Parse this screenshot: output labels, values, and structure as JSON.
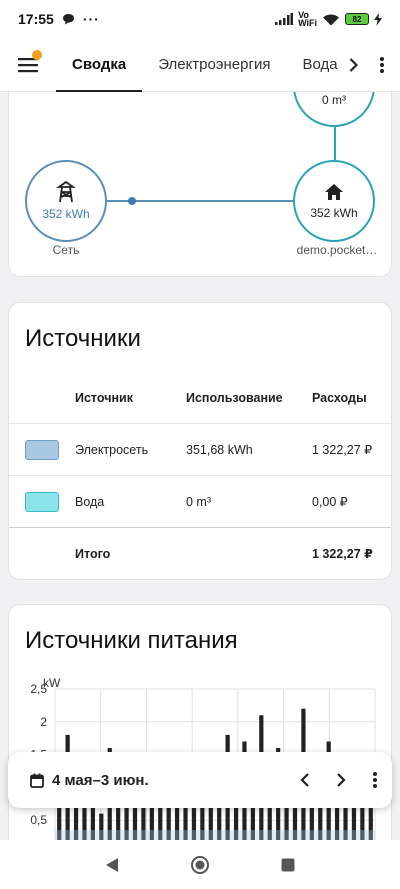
{
  "status_bar": {
    "time": "17:55",
    "network_label_top": "Vo",
    "network_label_bottom": "WiFi",
    "battery": "82"
  },
  "app_bar": {
    "tabs": [
      {
        "label": "Сводка",
        "active": true
      },
      {
        "label": "Электроэнергия",
        "active": false
      },
      {
        "label": "Вода",
        "active": false
      }
    ]
  },
  "flow": {
    "water_value": "0 m³",
    "grid_value": "352 kWh",
    "grid_label": "Сеть",
    "home_value": "352 kWh",
    "home_label": "demo.pocket…"
  },
  "sources": {
    "title": "Источники",
    "headers": {
      "source": "Источник",
      "usage": "Использование",
      "cost": "Расходы"
    },
    "rows": [
      {
        "name": "Электросеть",
        "usage": "351,68 kWh",
        "cost": "1 322,27 ₽",
        "color": "#a9c8e2",
        "border": "#6f9fc6"
      },
      {
        "name": "Вода",
        "usage": "0 m³",
        "cost": "0,00 ₽",
        "color": "#8de3ea",
        "border": "#3bbcc8"
      }
    ],
    "total": {
      "label": "Итого",
      "cost": "1 322,27 ₽"
    }
  },
  "power": {
    "title": "Источники питания"
  },
  "chart_data": {
    "type": "bar",
    "title": "Источники питания",
    "ylabel": "kW",
    "yticks": [
      "0,5",
      "1",
      "1,5",
      "2",
      "2,5"
    ],
    "ylim": [
      0,
      2.5
    ],
    "series": [
      {
        "values": [
          0.8,
          1.8,
          0.7,
          0.9,
          1.0,
          0.6,
          1.6,
          0.7,
          0.9,
          0.8,
          1.2,
          0.7,
          0.9,
          0.8,
          1.1,
          0.7,
          0.8,
          1.0,
          0.9,
          0.7,
          1.8,
          0.8,
          1.7,
          1.0,
          2.1,
          0.9,
          1.6,
          0.8,
          1.0,
          2.2,
          1.5,
          0.9,
          1.7,
          0.8,
          1.5,
          1.0,
          0.9,
          1.2
        ]
      }
    ]
  },
  "date_bar": {
    "range": "4 мая–3 июн."
  }
}
